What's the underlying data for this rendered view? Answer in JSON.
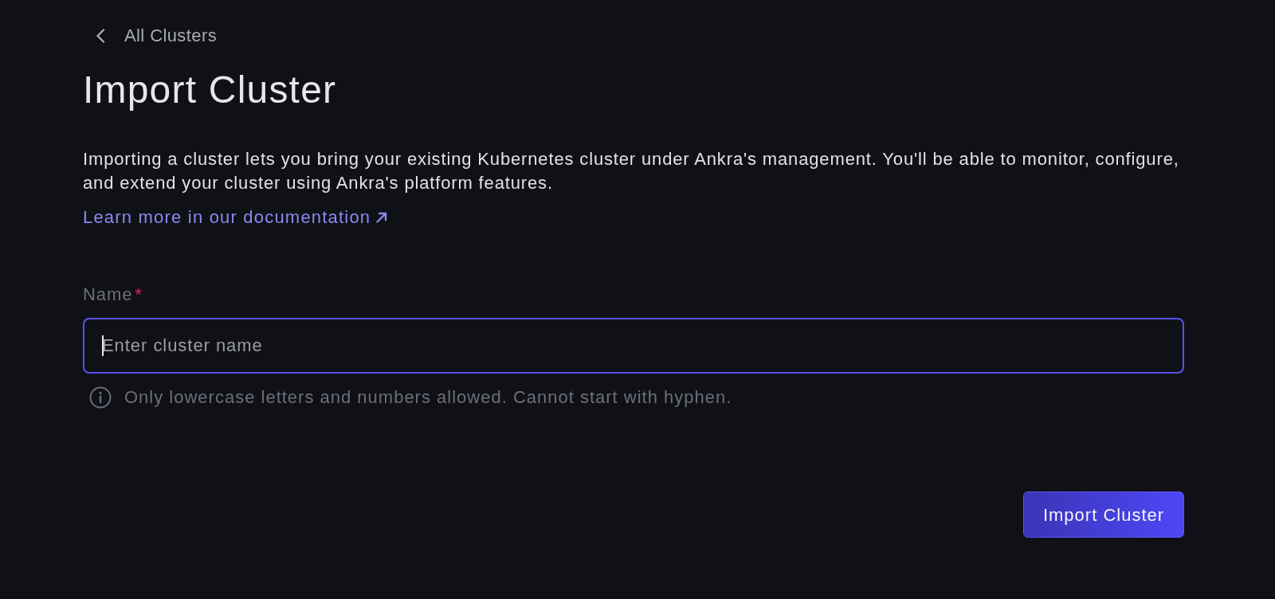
{
  "back_link": {
    "label": "All Clusters"
  },
  "title": "Import Cluster",
  "description": "Importing a cluster lets you bring your existing Kubernetes cluster under Ankra's management. You'll be able to monitor, configure, and extend your cluster using Ankra's platform features.",
  "docs_link": {
    "label": "Learn more in our documentation"
  },
  "form": {
    "fields": [
      {
        "label": "Name",
        "required_mark": "*",
        "placeholder": "Enter cluster name",
        "focused": true,
        "hint": "Only lowercase letters and numbers allowed. Cannot start with hyphen."
      }
    ]
  },
  "submit_button": {
    "label": "Import Cluster"
  }
}
